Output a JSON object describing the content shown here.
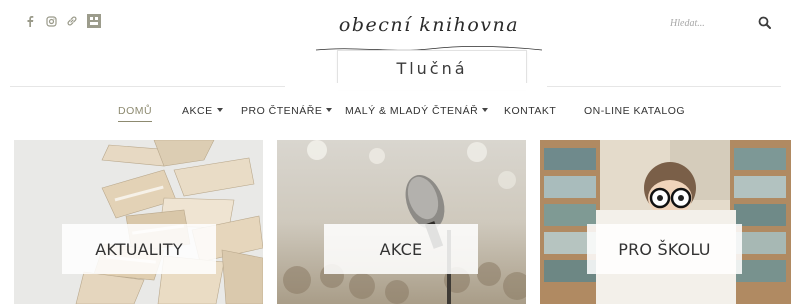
{
  "social": {
    "facebook_icon": "facebook-icon",
    "instagram_icon": "instagram-icon",
    "link_icon": "link-icon",
    "library_icon": "library-icon"
  },
  "logo": {
    "script_text": "obecní knihovna",
    "name": "Tlučná"
  },
  "search": {
    "placeholder": "Hledat...",
    "icon": "search-icon"
  },
  "nav": {
    "items": [
      {
        "label": "DOMŮ",
        "active": true,
        "dropdown": false
      },
      {
        "label": "AKCE",
        "active": false,
        "dropdown": true
      },
      {
        "label": "PRO ČTENÁŘE",
        "active": false,
        "dropdown": true
      },
      {
        "label": "MALÝ & MLADÝ ČTENÁŘ",
        "active": false,
        "dropdown": true
      },
      {
        "label": "KONTAKT",
        "active": false,
        "dropdown": false
      },
      {
        "label": "ON-LINE KATALOG",
        "active": false,
        "dropdown": false
      }
    ]
  },
  "tiles": [
    {
      "label": "AKTUALITY",
      "image": "books-image"
    },
    {
      "label": "AKCE",
      "image": "microphone-image"
    },
    {
      "label": "PRO ŠKOLU",
      "image": "child-reading-image"
    }
  ],
  "colors": {
    "accent": "#8d8a70",
    "icon_gray": "#9a9a8a",
    "text": "#333333"
  }
}
